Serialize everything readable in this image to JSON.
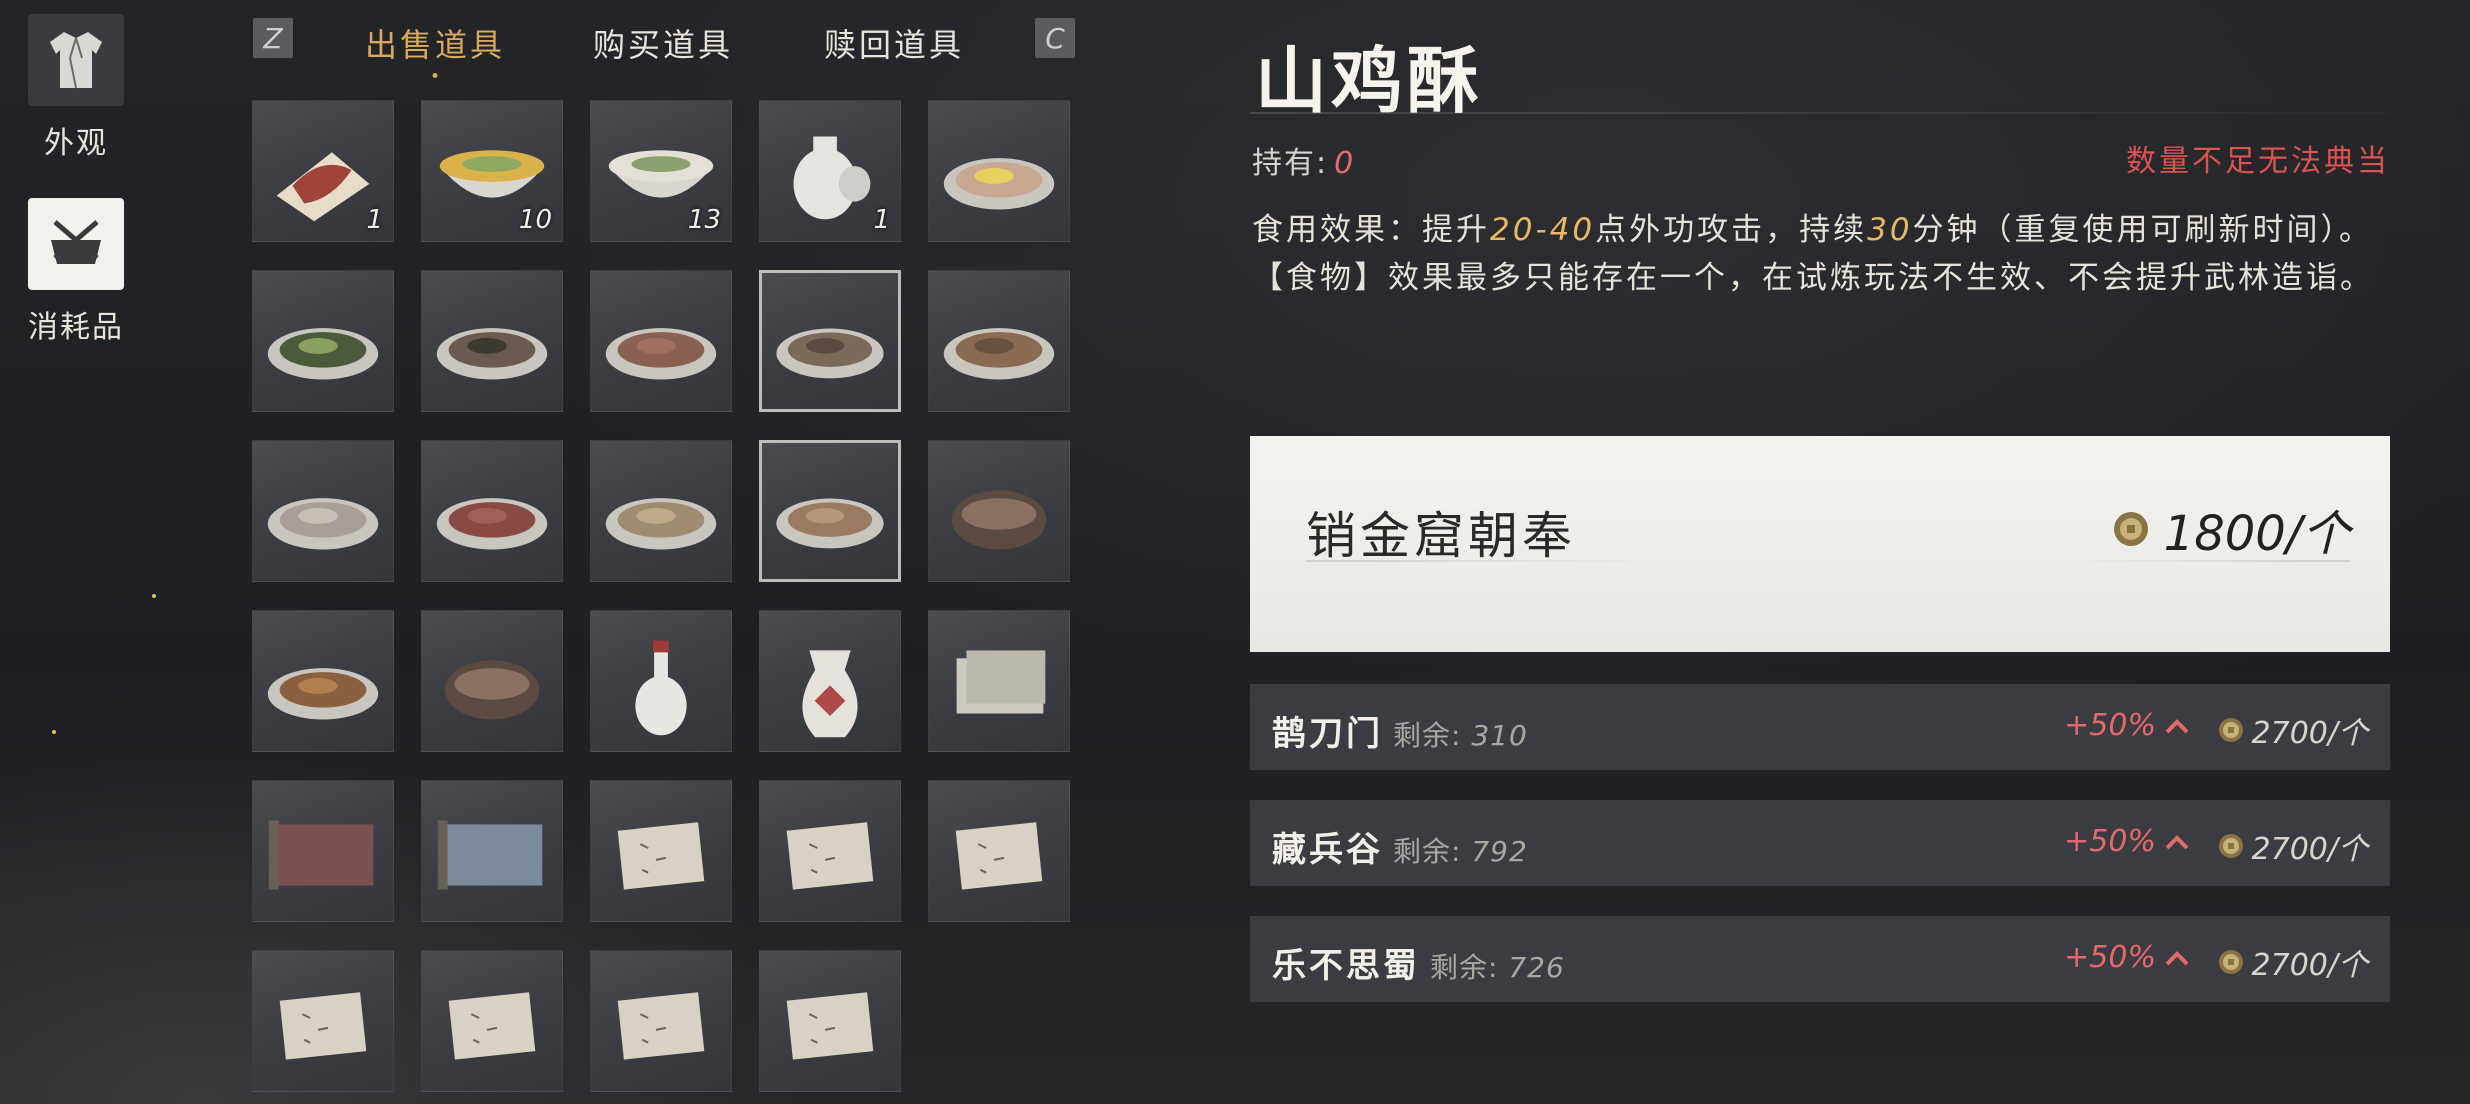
{
  "categories": [
    {
      "label": "外观",
      "icon": "robe-icon"
    },
    {
      "label": "消耗品",
      "icon": "consumable-icon"
    }
  ],
  "tabs": {
    "prev_key": "Z",
    "next_key": "C",
    "items": [
      {
        "label": "出售道具",
        "active": true
      },
      {
        "label": "购买道具",
        "active": false
      },
      {
        "label": "赎回道具",
        "active": false
      }
    ]
  },
  "inventory": {
    "slots": [
      {
        "icon": "meat-icon",
        "qty": "1"
      },
      {
        "icon": "soup-bowl-icon",
        "qty": "10"
      },
      {
        "icon": "noodle-bowl-icon",
        "qty": "13"
      },
      {
        "icon": "porcelain-jar-icon",
        "qty": "1"
      },
      {
        "icon": "egg-plate-icon",
        "qty": ""
      },
      {
        "icon": "vegetable-plate-icon",
        "qty": ""
      },
      {
        "icon": "fish-plate-icon",
        "qty": ""
      },
      {
        "icon": "braised-bowl-icon",
        "qty": ""
      },
      {
        "icon": "fish-dish-icon",
        "qty": "",
        "selected": true
      },
      {
        "icon": "stew-plate-icon",
        "qty": ""
      },
      {
        "icon": "dumpling-plate-icon",
        "qty": ""
      },
      {
        "icon": "sliced-meat-icon",
        "qty": ""
      },
      {
        "icon": "chicken-plate-icon",
        "qty": ""
      },
      {
        "icon": "pastry-plate-icon",
        "qty": "",
        "selected": true
      },
      {
        "icon": "clay-pot-icon",
        "qty": ""
      },
      {
        "icon": "noodles-plate-icon",
        "qty": ""
      },
      {
        "icon": "stone-pot-icon",
        "qty": ""
      },
      {
        "icon": "wine-bottle-icon",
        "qty": ""
      },
      {
        "icon": "wine-vase-icon",
        "qty": ""
      },
      {
        "icon": "letter-stack-icon",
        "qty": ""
      },
      {
        "icon": "red-scroll-icon",
        "qty": ""
      },
      {
        "icon": "blue-scroll-icon",
        "qty": ""
      },
      {
        "icon": "paper-note-icon",
        "qty": ""
      },
      {
        "icon": "paper-note-icon",
        "qty": ""
      },
      {
        "icon": "paper-note-icon",
        "qty": ""
      },
      {
        "icon": "paper-note-icon",
        "qty": ""
      },
      {
        "icon": "paper-note-icon",
        "qty": ""
      },
      {
        "icon": "paper-note-icon",
        "qty": ""
      },
      {
        "icon": "paper-note-icon",
        "qty": ""
      },
      {
        "icon": "",
        "qty": "",
        "empty": true
      }
    ]
  },
  "detail": {
    "title": "山鸡酥",
    "owned_label": "持有:",
    "owned_value": "0",
    "warning": "数量不足无法典当",
    "desc_parts": [
      "食用效果：提升",
      "20-40",
      "点外功攻击，持续",
      "30",
      "分钟（重复使用可刷新时间）。【食物】效果最多只能存在一个，在试炼玩法不生效、不会提升武林造诣。"
    ]
  },
  "buyer": {
    "name": "销金窟朝奉",
    "price": "1800/个"
  },
  "sect_rows": [
    {
      "name": "鹊刀门",
      "remain_label": "剩余:",
      "remain": "310",
      "bonus": "+50%",
      "price": "2700/个"
    },
    {
      "name": "藏兵谷",
      "remain_label": "剩余:",
      "remain": "792",
      "bonus": "+50%",
      "price": "2700/个"
    },
    {
      "name": "乐不思蜀",
      "remain_label": "剩余:",
      "remain": "726",
      "bonus": "+50%",
      "price": "2700/个"
    }
  ],
  "colors": {
    "accent_gold": "#d8a95c",
    "warning_red": "#d9534f",
    "bonus_red": "#e36a6a",
    "highlight": "#e8b866"
  }
}
